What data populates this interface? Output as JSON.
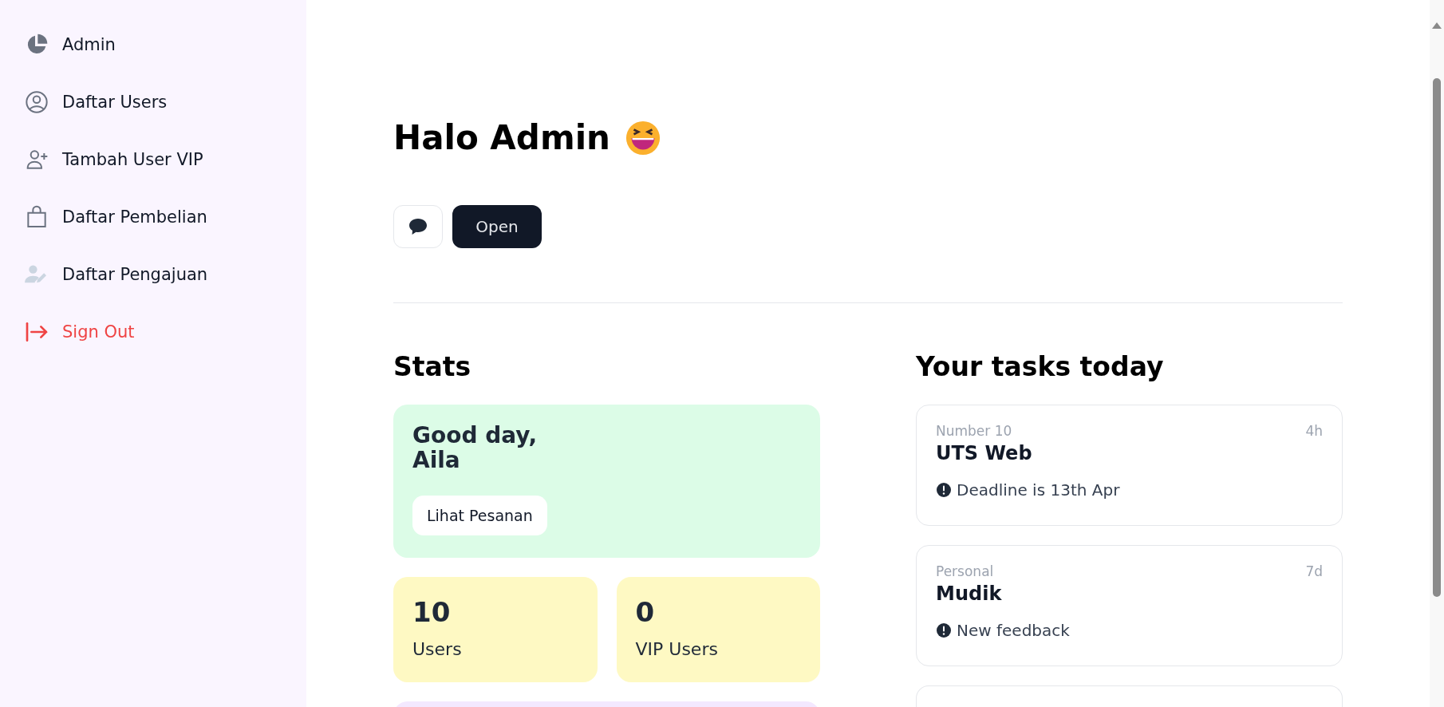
{
  "sidebar": {
    "items": [
      {
        "label": "Admin",
        "kind": "dashboard",
        "selected": false
      },
      {
        "label": "Daftar Users",
        "kind": "users",
        "selected": false
      },
      {
        "label": "Tambah User VIP",
        "kind": "adduser",
        "selected": false
      },
      {
        "label": "Daftar Pembelian",
        "kind": "purchases",
        "selected": false
      },
      {
        "label": "Daftar Pengajuan",
        "kind": "submissions",
        "selected": false
      },
      {
        "label": "Sign Out",
        "kind": "signout",
        "selected": false
      }
    ]
  },
  "header": {
    "title": "Halo Admin",
    "buttons": [
      {
        "kind": "icon"
      },
      {
        "kind": "text",
        "label": "Open"
      }
    ]
  },
  "stats": {
    "title": "Stats",
    "greeting": {
      "line1": "Good day,",
      "line2": "Aila",
      "button": "Lihat Pesanan"
    },
    "cards": [
      {
        "value": "10",
        "label": "Users",
        "color": "#fef9c3"
      },
      {
        "value": "0",
        "label": "VIP Users",
        "color": "#fef9c3"
      },
      {
        "color": "#f3e8ff"
      }
    ]
  },
  "tasks": {
    "title": "Your tasks today",
    "items": [
      {
        "kind": "full",
        "category": "Number 10",
        "time": "4h",
        "title": "UTS Web",
        "note": "Deadline is 13th Apr"
      },
      {
        "kind": "full",
        "category": "Personal",
        "time": "7d",
        "title": "Mudik",
        "note": "New feedback"
      },
      {
        "kind": "stub"
      }
    ]
  }
}
